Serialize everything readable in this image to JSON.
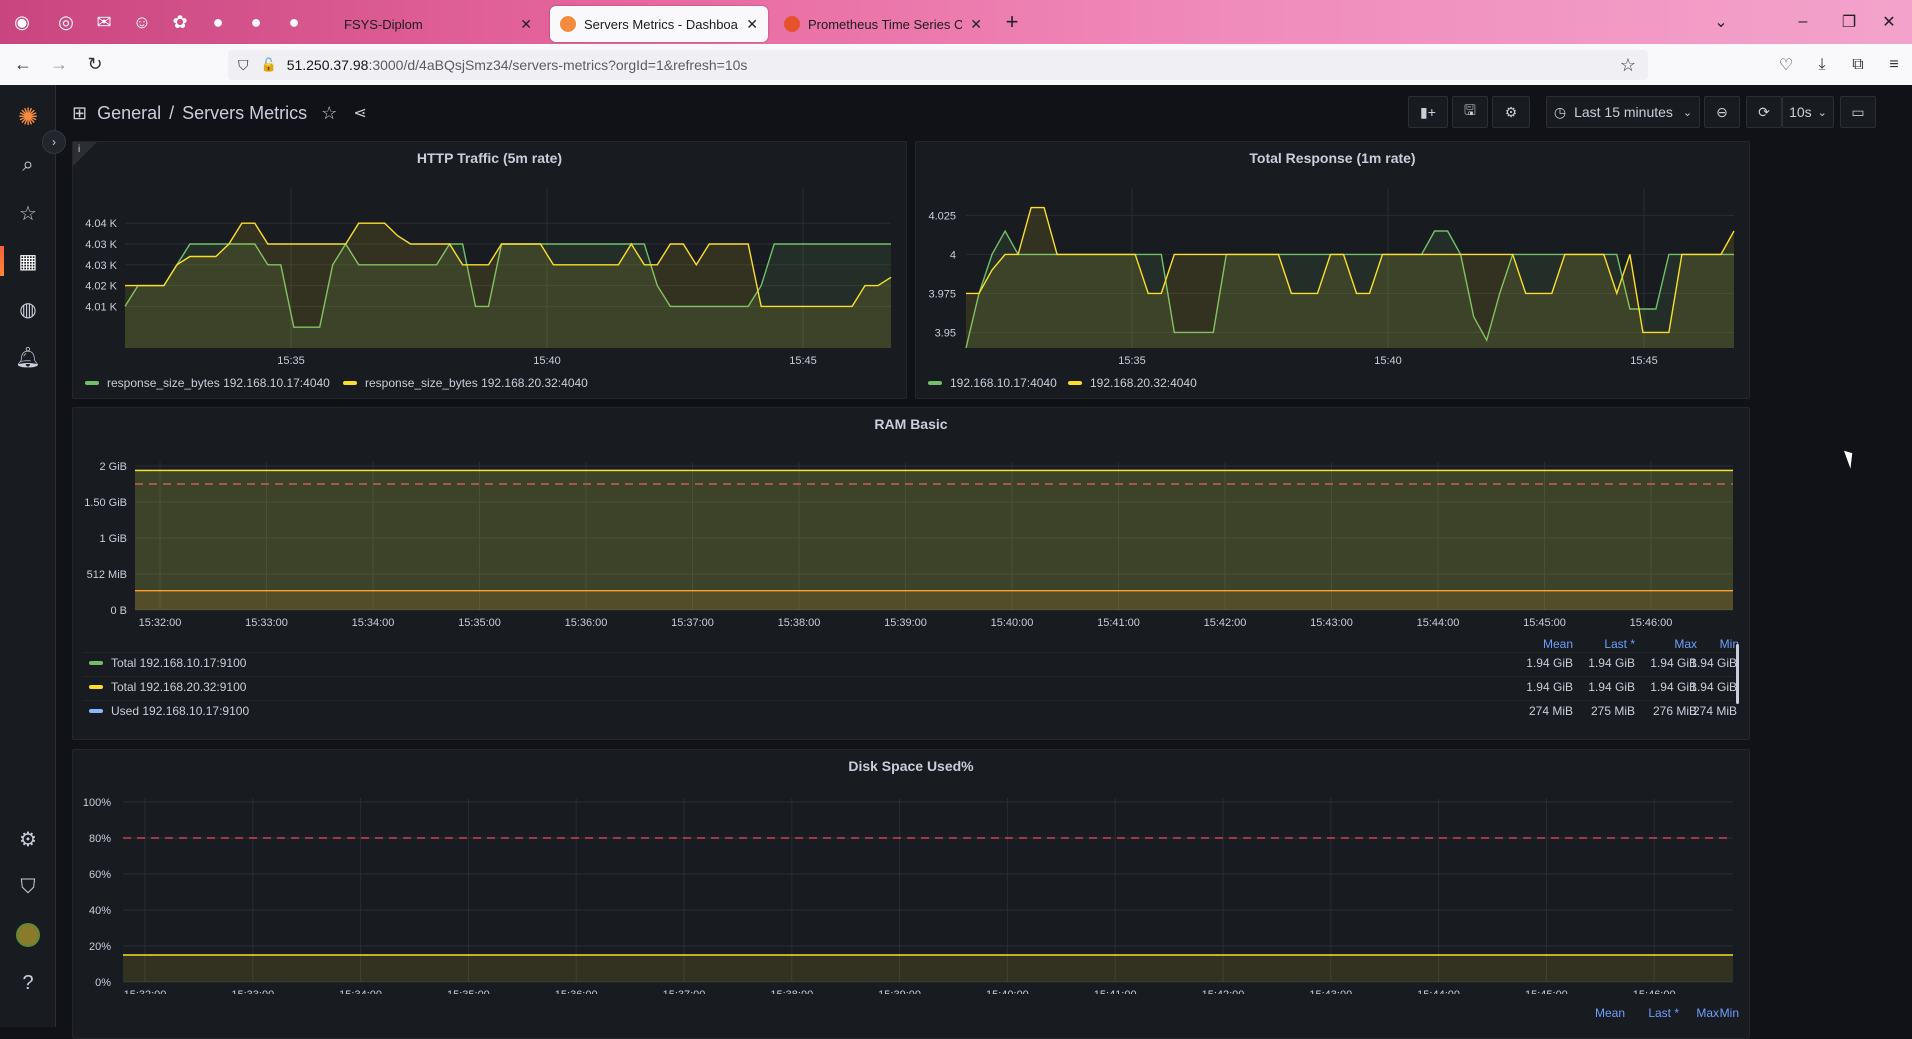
{
  "browser": {
    "tabs": [
      {
        "label": "FSYS-Diplom",
        "active": false
      },
      {
        "label": "Servers Metrics - Dashboards - G",
        "active": true
      },
      {
        "label": "Prometheus Time Series Collecti",
        "active": false
      }
    ],
    "url_host": "51.250.37.98",
    "url_path": ":3000/d/4aBQsjSmz34/servers-metrics?orgId=1&refresh=10s"
  },
  "breadcrumb": {
    "folder": "General",
    "separator": "/",
    "dashboard": "Servers Metrics"
  },
  "toolbar": {
    "time_range": "Last 15 minutes",
    "refresh_interval": "10s"
  },
  "colors": {
    "green": "#73bf69",
    "yellow": "#fade2a",
    "blue": "#8ab8ff",
    "orange": "#ff9830",
    "threshold": "#f2495c"
  },
  "panels": {
    "http": {
      "title": "HTTP Traffic (5m rate)",
      "info": "i",
      "y_ticks": [
        "4.04 K",
        "4.03 K",
        "4.03 K",
        "4.02 K",
        "4.01 K"
      ],
      "x_ticks": [
        "15:35",
        "15:40",
        "15:45"
      ],
      "legend": [
        "response_size_bytes 192.168.10.17:4040",
        "response_size_bytes 192.168.20.32:4040"
      ]
    },
    "total": {
      "title": "Total Response (1m rate)",
      "y_ticks": [
        "4.025",
        "4",
        "3.975",
        "3.95"
      ],
      "x_ticks": [
        "15:35",
        "15:40",
        "15:45"
      ],
      "legend": [
        "192.168.10.17:4040",
        "192.168.20.32:4040"
      ]
    },
    "ram": {
      "title": "RAM Basic",
      "y_ticks": [
        "2 GiB",
        "1.50 GiB",
        "1 GiB",
        "512 MiB",
        "0 B"
      ],
      "x_ticks": [
        "15:32:00",
        "15:33:00",
        "15:34:00",
        "15:35:00",
        "15:36:00",
        "15:37:00",
        "15:38:00",
        "15:39:00",
        "15:40:00",
        "15:41:00",
        "15:42:00",
        "15:43:00",
        "15:44:00",
        "15:45:00",
        "15:46:00"
      ],
      "legend_headers": [
        "Mean",
        "Last *",
        "Max",
        "Min"
      ],
      "legend_rows": [
        {
          "name": "Total 192.168.10.17:9100",
          "color": "#73bf69",
          "values": [
            "1.94 GiB",
            "1.94 GiB",
            "1.94 GiB",
            "1.94 GiB"
          ]
        },
        {
          "name": "Total 192.168.20.32:9100",
          "color": "#fade2a",
          "values": [
            "1.94 GiB",
            "1.94 GiB",
            "1.94 GiB",
            "1.94 GiB"
          ]
        },
        {
          "name": "Used 192.168.10.17:9100",
          "color": "#8ab8ff",
          "values": [
            "274 MiB",
            "275 MiB",
            "276 MiB",
            "274 MiB"
          ]
        }
      ]
    },
    "disk": {
      "title": "Disk Space Used%",
      "y_ticks": [
        "100%",
        "80%",
        "60%",
        "40%",
        "20%",
        "0%"
      ],
      "x_ticks": [
        "15:32:00",
        "15:33:00",
        "15:34:00",
        "15:35:00",
        "15:36:00",
        "15:37:00",
        "15:38:00",
        "15:39:00",
        "15:40:00",
        "15:41:00",
        "15:42:00",
        "15:43:00",
        "15:44:00",
        "15:45:00",
        "15:46:00"
      ],
      "legend_headers": [
        "Mean",
        "Last *",
        "Max",
        "Min"
      ]
    }
  },
  "chart_data": [
    {
      "type": "line",
      "title": "HTTP Traffic (5m rate)",
      "ylim": [
        4.005,
        4.0425
      ],
      "y_unit": "K",
      "series": [
        {
          "name": "response_size_bytes 192.168.10.17:4040",
          "values": [
            4.015,
            4.02,
            4.02,
            4.02,
            4.025,
            4.03,
            4.03,
            4.03,
            4.03,
            4.03,
            4.03,
            4.025,
            4.025,
            4.01,
            4.01,
            4.01,
            4.025,
            4.03,
            4.025,
            4.025,
            4.025,
            4.025,
            4.025,
            4.025,
            4.025,
            4.03,
            4.03,
            4.015,
            4.015,
            4.03,
            4.03,
            4.03,
            4.03,
            4.03,
            4.03,
            4.03,
            4.03,
            4.03,
            4.03,
            4.03,
            4.03,
            4.02,
            4.015,
            4.015,
            4.015,
            4.015,
            4.015,
            4.015,
            4.015,
            4.02,
            4.03,
            4.03,
            4.03,
            4.03,
            4.03,
            4.03,
            4.03,
            4.03,
            4.03,
            4.03
          ]
        },
        {
          "name": "response_size_bytes 192.168.20.32:4040",
          "values": [
            4.02,
            4.02,
            4.02,
            4.02,
            4.025,
            4.027,
            4.027,
            4.027,
            4.03,
            4.035,
            4.035,
            4.03,
            4.03,
            4.03,
            4.03,
            4.03,
            4.03,
            4.03,
            4.035,
            4.035,
            4.035,
            4.032,
            4.03,
            4.03,
            4.03,
            4.03,
            4.025,
            4.025,
            4.025,
            4.03,
            4.03,
            4.03,
            4.03,
            4.025,
            4.025,
            4.025,
            4.025,
            4.025,
            4.025,
            4.03,
            4.025,
            4.025,
            4.03,
            4.03,
            4.025,
            4.03,
            4.03,
            4.03,
            4.03,
            4.015,
            4.015,
            4.015,
            4.015,
            4.015,
            4.015,
            4.015,
            4.015,
            4.02,
            4.02,
            4.022
          ]
        }
      ]
    },
    {
      "type": "line",
      "title": "Total Response (1m rate)",
      "ylim": [
        3.94,
        4.04
      ],
      "series": [
        {
          "name": "192.168.10.17:4040",
          "values": [
            3.94,
            3.975,
            4,
            4.015,
            4,
            4,
            4,
            4,
            4,
            4,
            4,
            4,
            4,
            4,
            4,
            4,
            3.95,
            3.95,
            3.95,
            3.95,
            4,
            4,
            4,
            4,
            4,
            4,
            4,
            4,
            4,
            4,
            4,
            4,
            4,
            4,
            4,
            4,
            4.015,
            4.015,
            4,
            3.96,
            3.945,
            3.975,
            4,
            4,
            4,
            4,
            4,
            4,
            4,
            4,
            4,
            3.965,
            3.965,
            3.965,
            4,
            4,
            4,
            4,
            4,
            4
          ]
        },
        {
          "name": "192.168.20.32:4040",
          "values": [
            3.975,
            3.975,
            3.99,
            4,
            4,
            4.03,
            4.03,
            4,
            4,
            4,
            4,
            4,
            4,
            4,
            3.975,
            3.975,
            4,
            4,
            4,
            4,
            4,
            4,
            4,
            4,
            4,
            3.975,
            3.975,
            3.975,
            4,
            4,
            3.975,
            3.975,
            4,
            4,
            4,
            4,
            4,
            4,
            4,
            4,
            4,
            4,
            4,
            3.975,
            3.975,
            3.975,
            4,
            4,
            4,
            4,
            3.975,
            4,
            3.95,
            3.95,
            3.95,
            4,
            4,
            4,
            4,
            4.015
          ]
        }
      ]
    },
    {
      "type": "line",
      "title": "RAM Basic",
      "ylim": [
        0,
        2048
      ],
      "y_unit": "MiB",
      "threshold": 1792,
      "series": [
        {
          "name": "Total 192.168.10.17:9100",
          "values": [
            1986,
            1986
          ]
        },
        {
          "name": "Total 192.168.20.32:9100",
          "values": [
            1986,
            1986
          ]
        },
        {
          "name": "Used 192.168.10.17:9100",
          "values": [
            274,
            275
          ]
        }
      ]
    },
    {
      "type": "line",
      "title": "Disk Space Used%",
      "ylim": [
        0,
        100
      ],
      "threshold": 80,
      "series": [
        {
          "values": [
            15,
            15
          ]
        }
      ]
    }
  ]
}
